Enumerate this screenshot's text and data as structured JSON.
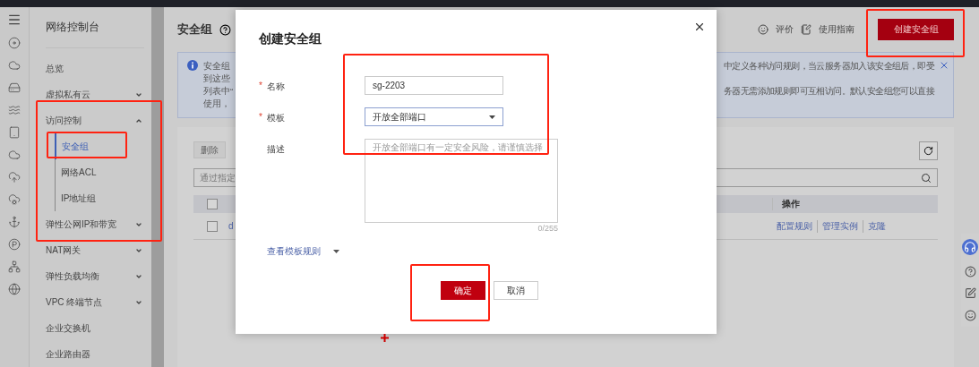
{
  "sidebar": {
    "title": "网络控制台",
    "items": [
      {
        "label": "总览"
      },
      {
        "label": "虚拟私有云",
        "expanded": false
      },
      {
        "label": "访问控制",
        "expanded": true,
        "children": [
          {
            "label": "安全组",
            "selected": true
          },
          {
            "label": "网络ACL",
            "selected": false
          },
          {
            "label": "IP地址组",
            "selected": false
          }
        ]
      },
      {
        "label": "弹性公网IP和带宽",
        "expanded": false
      },
      {
        "label": "NAT网关",
        "expanded": false
      },
      {
        "label": "弹性负载均衡",
        "expanded": false
      },
      {
        "label": "VPC 终端节点",
        "expanded": false
      },
      {
        "label": "企业交换机"
      },
      {
        "label": "企业路由器"
      }
    ]
  },
  "header": {
    "title": "安全组",
    "links": [
      "评价",
      "使用指南"
    ],
    "primary_button": "创建安全组"
  },
  "notice": {
    "left_lines": [
      "安全组",
      "到这些",
      "列表中“",
      "使用，"
    ],
    "right_lines": [
      "中定义各种访问规则，当云服务器加入该安全组后，即受",
      "务器无需添加规则即可互相访问。默认安全组您可以直接"
    ]
  },
  "toolbar": {
    "delete_button": "删除",
    "search_placeholder": "通过指定"
  },
  "table": {
    "columns": [
      "操作"
    ],
    "rows": [
      {
        "name": "d",
        "checked": false,
        "actions": [
          "配置规则",
          "管理实例",
          "克隆"
        ]
      }
    ],
    "header_checked": false
  },
  "dialog": {
    "title": "创建安全组",
    "required_mark": "*",
    "fields": [
      {
        "kind": "input",
        "label": "名称",
        "required": true,
        "value": "sg-2203"
      },
      {
        "kind": "select",
        "label": "模板",
        "required": true,
        "value": "开放全部端口"
      },
      {
        "kind": "textarea",
        "label": "描述",
        "required": false,
        "placeholder": "开放全部端口有一定安全风险，请谨慎选择",
        "counter": "0/255"
      }
    ],
    "link": "查看模板规则",
    "buttons": [
      {
        "label": "确定",
        "kind": "primary"
      },
      {
        "label": "取消",
        "kind": "default"
      }
    ]
  }
}
